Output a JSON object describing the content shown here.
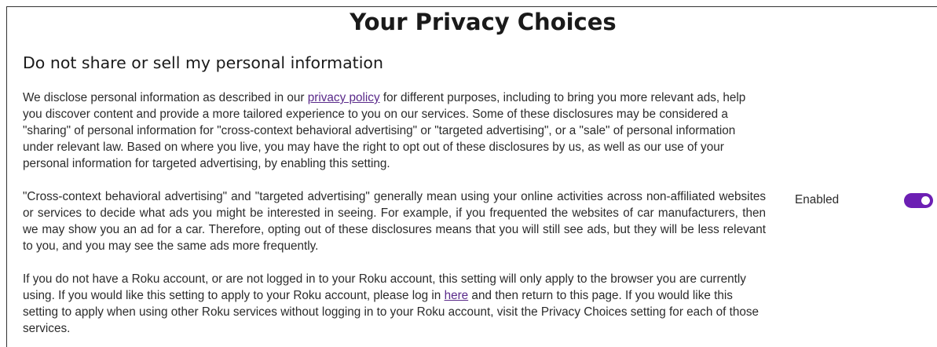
{
  "page": {
    "title": "Your Privacy Choices"
  },
  "section": {
    "title": "Do not share or sell my personal information"
  },
  "paragraph1": {
    "before_link": "We disclose personal information as described in our ",
    "link_text": "privacy policy",
    "after_link": " for different purposes, including to bring you more relevant ads, help you discover content and provide a more tailored experience to you on our services. Some of these disclosures may be considered a \"sharing\" of personal information for \"cross-context behavioral advertising\" or \"targeted advertising\", or a \"sale\" of personal information under relevant law. Based on where you live, you may have the right to opt out of these disclosures by us, as well as our use of your personal information for targeted advertising, by enabling this setting."
  },
  "paragraph2": {
    "text": "\"Cross-context behavioral advertising\" and \"targeted advertising\" generally mean using your online activities across non-affiliated websites or services to decide what ads you might be interested in seeing. For example, if you frequented the websites of car manufacturers, then we may show you an ad for a car. Therefore, opting out of these disclosures means that you will still see ads, but they will be less relevant to you, and you may see the same ads more frequently."
  },
  "paragraph3": {
    "before_link": "If you do not have a Roku account, or are not logged in to your Roku account, this setting will only apply to the browser you are currently using. If you would like this setting to apply to your Roku account, please log in ",
    "link_text": "here",
    "after_link": " and then return to this page. If you would like this setting to apply when using other Roku services without logging in to your Roku account, visit the Privacy Choices setting for each of those services."
  },
  "setting": {
    "status_label": "Enabled",
    "enabled": true
  },
  "colors": {
    "toggle_on": "#6c1fb3",
    "link": "#5a2a8a"
  }
}
